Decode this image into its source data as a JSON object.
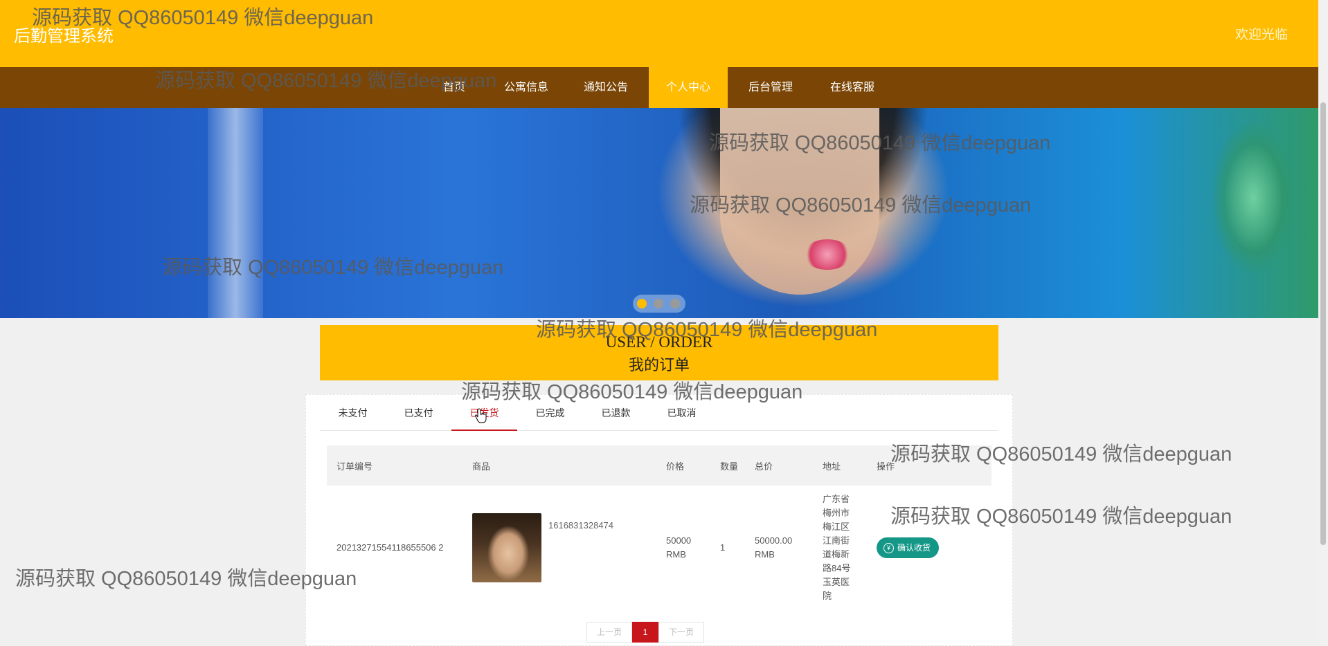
{
  "header": {
    "site_title": "后勤管理系统",
    "welcome": "欢迎光临"
  },
  "nav": {
    "items": [
      {
        "label": "首页",
        "active": false
      },
      {
        "label": "公寓信息",
        "active": false
      },
      {
        "label": "通知公告",
        "active": false
      },
      {
        "label": "个人中心",
        "active": true
      },
      {
        "label": "后台管理",
        "active": false
      },
      {
        "label": "在线客服",
        "active": false
      }
    ]
  },
  "carousel": {
    "slide_count": 3,
    "active_index": 0
  },
  "order_section": {
    "title_en": "USER / ORDER",
    "title_zh": "我的订单"
  },
  "tabs": [
    {
      "label": "未支付",
      "active": false
    },
    {
      "label": "已支付",
      "active": false
    },
    {
      "label": "已发货",
      "active": true
    },
    {
      "label": "已完成",
      "active": false
    },
    {
      "label": "已退款",
      "active": false
    },
    {
      "label": "已取消",
      "active": false
    }
  ],
  "table": {
    "headers": {
      "order_no": "订单编号",
      "product": "商品",
      "price": "价格",
      "quantity": "数量",
      "total": "总价",
      "address": "地址",
      "action": "操作"
    },
    "rows": [
      {
        "order_no": "20213271554118655506 2",
        "product_name": "1616831328474",
        "price": "50000 RMB",
        "quantity": "1",
        "total": "50000.00 RMB",
        "address": "广东省梅州市梅江区江南街道梅新路84号玉英医院",
        "action_label": "确认收货",
        "action_icon": "yen-icon"
      }
    ]
  },
  "pagination": {
    "prev_label": "上一页",
    "current_page": "1",
    "next_label": "下一页"
  },
  "watermark": "源码获取 QQ86050149 微信deepguan",
  "colors": {
    "primary": "#ffbc00",
    "nav_bg": "#7a4505",
    "active_tab": "#c8161d",
    "action_button": "#159788"
  }
}
